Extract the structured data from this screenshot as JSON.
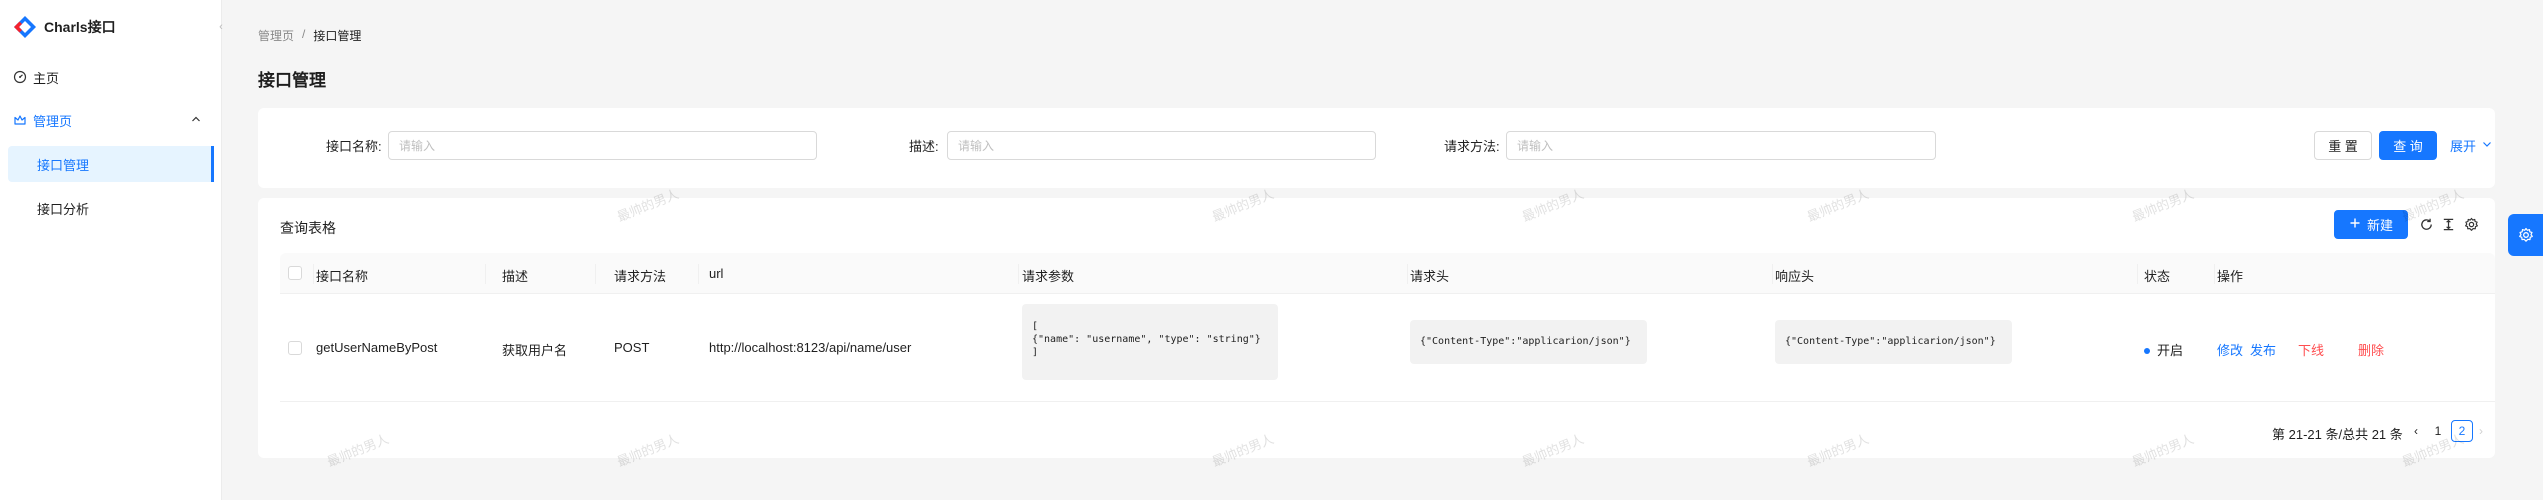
{
  "app": {
    "title": "Charls接口"
  },
  "sidebar": {
    "items": [
      {
        "label": "主页",
        "icon": "dashboard-icon"
      },
      {
        "label": "管理页",
        "icon": "crown-icon",
        "expanded": true,
        "children": [
          {
            "label": "接口管理",
            "active": true
          },
          {
            "label": "接口分析",
            "active": false
          }
        ]
      }
    ]
  },
  "breadcrumb": {
    "parent": "管理页",
    "separator": "/",
    "current": "接口管理"
  },
  "page": {
    "title": "接口管理"
  },
  "search": {
    "fields": [
      {
        "label": "接口名称:",
        "placeholder": "请输入",
        "value": ""
      },
      {
        "label": "描述:",
        "placeholder": "请输入",
        "value": ""
      },
      {
        "label": "请求方法:",
        "placeholder": "请输入",
        "value": ""
      }
    ],
    "reset_label": "重 置",
    "query_label": "查 询",
    "expand_label": "展开"
  },
  "table": {
    "title": "查询表格",
    "new_label": "新建",
    "columns": [
      "接口名称",
      "描述",
      "请求方法",
      "url",
      "请求参数",
      "请求头",
      "响应头",
      "状态",
      "操作"
    ],
    "rows": [
      {
        "name": "getUserNameByPost",
        "description": "获取用户名",
        "method": "POST",
        "url": "http://localhost:8123/api/name/user",
        "request_params": "[\n{\"name\": \"username\", \"type\": \"string\"}\n]",
        "request_header": "{\"Content-Type\":\"applicarion/json\"}",
        "response_header": "{\"Content-Type\":\"applicarion/json\"}",
        "status": "开启",
        "actions": {
          "edit": "修改",
          "publish": "发布",
          "offline": "下线",
          "delete": "删除"
        }
      }
    ],
    "pagination": {
      "total_text": "第 21-21 条/总共 21 条",
      "pages": [
        "1",
        "2"
      ],
      "current": "2"
    }
  },
  "watermark": {
    "text": "最帅的男人"
  },
  "colors": {
    "primary": "#1677ff",
    "danger": "#ff4d4f",
    "background": "#f5f5f5"
  }
}
